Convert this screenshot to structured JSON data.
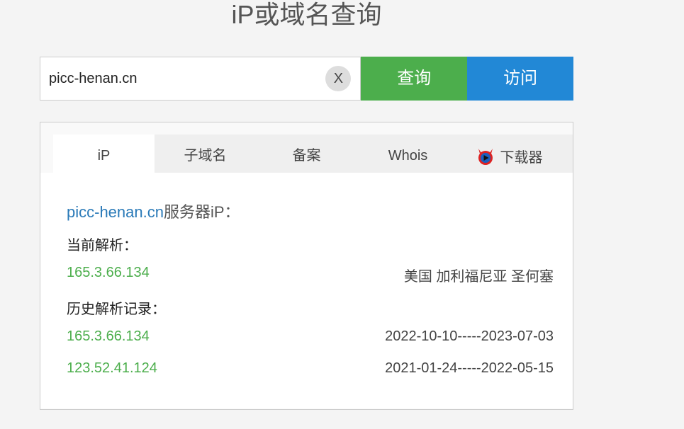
{
  "header": {
    "title": "iP或域名查询"
  },
  "search": {
    "value": "picc-henan.cn",
    "clear_label": "X",
    "query_label": "查询",
    "visit_label": "访问"
  },
  "tabs": [
    {
      "label": "iP"
    },
    {
      "label": "子域名"
    },
    {
      "label": "备案"
    },
    {
      "label": "Whois"
    },
    {
      "label": "下载器",
      "icon": "devil-play-icon"
    }
  ],
  "result": {
    "domain": "picc-henan.cn",
    "heading_suffix": "服务器iP：",
    "current_label": "当前解析：",
    "current": {
      "ip": "165.3.66.134",
      "location": "美国 加利福尼亚 圣何塞"
    },
    "history_label": "历史解析记录：",
    "history": [
      {
        "ip": "165.3.66.134",
        "range": "2022-10-10-----2023-07-03"
      },
      {
        "ip": "123.52.41.124",
        "range": "2021-01-24-----2022-05-15"
      }
    ]
  },
  "colors": {
    "green": "#4cae4c",
    "blue": "#2288d6",
    "link": "#2a7ab8"
  }
}
